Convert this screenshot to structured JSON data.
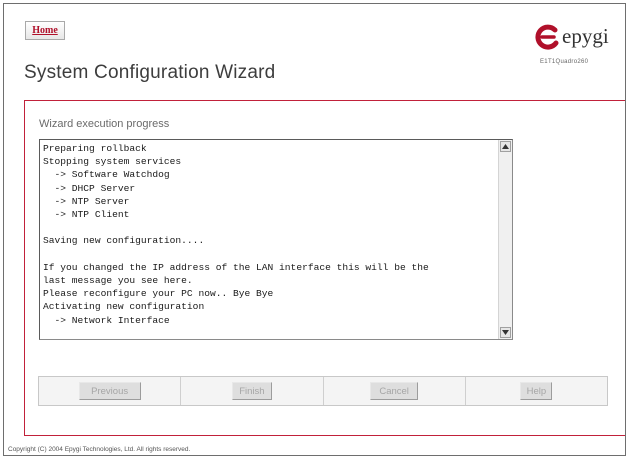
{
  "nav": {
    "home_label": "Home"
  },
  "header": {
    "title": "System Configuration Wizard",
    "brand": "epygi",
    "model": "E1T1Quadro260"
  },
  "progress": {
    "label": "Wizard execution progress",
    "log_lines": [
      "Preparing rollback",
      "Stopping system services",
      "  -> Software Watchdog",
      "  -> DHCP Server",
      "  -> NTP Server",
      "  -> NTP Client",
      "",
      "Saving new configuration....",
      "",
      "If you changed the IP address of the LAN interface this will be the",
      "last message you see here.",
      "Please reconfigure your PC now.. Bye Bye",
      "Activating new configuration",
      "  -> Network Interface"
    ]
  },
  "buttons": {
    "previous": "Previous",
    "finish": "Finish",
    "cancel": "Cancel",
    "help": "Help"
  },
  "footer": {
    "copyright": "Copyright (C) 2004 Epygi Technologies, Ltd. All rights reserved."
  },
  "colors": {
    "accent": "#c1213a",
    "brand": "#b0102a"
  }
}
